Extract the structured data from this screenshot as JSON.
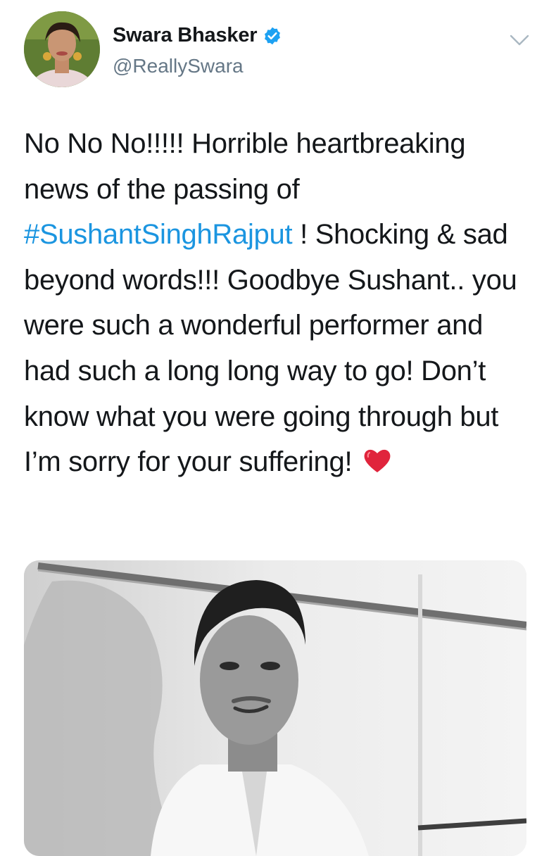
{
  "tweet": {
    "author": {
      "display_name": "Swara Bhasker",
      "handle": "@ReallySwara",
      "verified": true,
      "avatar_icon": "profile-photo"
    },
    "text_lines": [
      {
        "text": "No No No!!!!! Horrible heartbreaking news of the passing of "
      },
      {
        "hashtag": "#SushantSinghRajput"
      },
      {
        "text": " ! Shocking & sad beyond words!!! Goodbye Sushant.. you were such a wonderful performer and had such a long long way to go! Don’t know what you were going through but I’m sorry for your suffering! "
      }
    ],
    "emoji": "heart",
    "media": {
      "type": "photo"
    },
    "menu_icon": "chevron-down-icon"
  },
  "colors": {
    "text": "#14171a",
    "secondary": "#657786",
    "link": "#1b95e0",
    "verified": "#1da1f2",
    "heart": "#e0243c"
  }
}
